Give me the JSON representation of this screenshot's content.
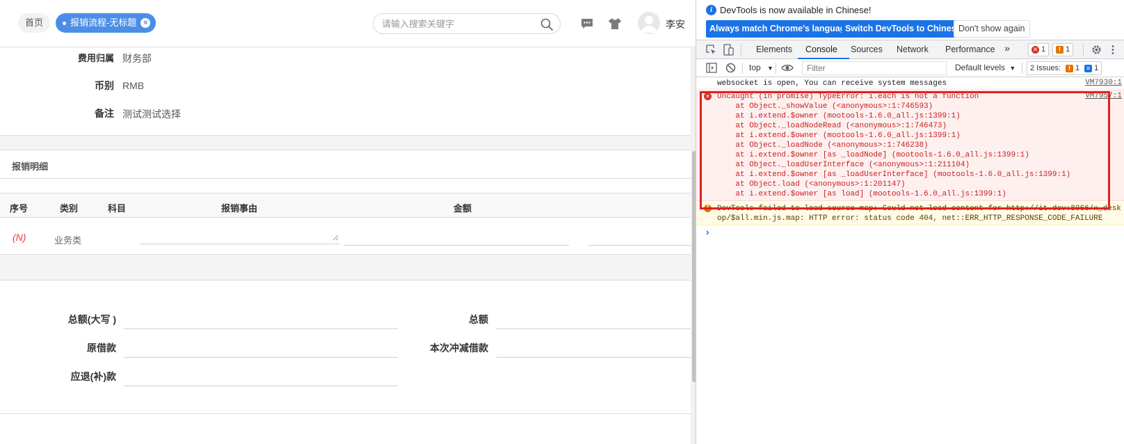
{
  "app": {
    "tabs": {
      "home": "首页",
      "active": "报销流程-无标题",
      "close": "×"
    },
    "search": {
      "placeholder": "请输入搜索关键字"
    },
    "user": {
      "name": "李安"
    },
    "info_fields": [
      {
        "label": "费用归属",
        "value": "财务部"
      },
      {
        "label": "币别",
        "value": "RMB"
      },
      {
        "label": "备注",
        "value": "测试测试选择"
      }
    ],
    "section_title": "报销明细",
    "table": {
      "headers": [
        "序号",
        "类别",
        "科目",
        "报销事由",
        "金额"
      ],
      "row": {
        "mark": "(N)",
        "category": "业务类"
      }
    },
    "summary": {
      "total_upper": "总额(大写 )",
      "total": "总额",
      "original_loan": "原借款",
      "offset_loan": "本次冲减借款",
      "refund": "应退(补)款"
    }
  },
  "devtools": {
    "info": {
      "text": "DevTools is now available in Chinese!",
      "btn_match": "Always match Chrome's language",
      "btn_switch": "Switch DevTools to Chinese",
      "btn_dismiss": "Don't show again"
    },
    "tabs": [
      "Elements",
      "Console",
      "Sources",
      "Network",
      "Performance"
    ],
    "more": "»",
    "error_count": "1",
    "warn_count": "1",
    "toolbar": {
      "context": "top",
      "filter_placeholder": "Filter",
      "levels": "Default levels",
      "issues_label": "2 Issues:",
      "issues_warn": "1",
      "issues_info": "1"
    },
    "messages": {
      "info": {
        "text": "websocket is open, You can receive system messages",
        "source": "VM7930:1"
      },
      "error": {
        "source": "VM7957:1",
        "lines": [
          "Uncaught (in promise) TypeError: i.each is not a function",
          "    at Object._showValue (<anonymous>:1:746593)",
          "    at i.extend.$owner (mootools-1.6.0_all.js:1399:1)",
          "    at Object._loadNodeRead (<anonymous>:1:746473)",
          "    at i.extend.$owner (mootools-1.6.0_all.js:1399:1)",
          "    at Object._loadNode (<anonymous>:1:746238)",
          "    at i.extend.$owner [as _loadNode] (mootools-1.6.0_all.js:1399:1)",
          "    at Object._loadUserInterface (<anonymous>:1:211104)",
          "    at i.extend.$owner [as _loadUserInterface] (mootools-1.6.0_all.js:1399:1)",
          "    at Object.load (<anonymous>:1:201147)",
          "    at i.extend.$owner [as load] (mootools-1.6.0_all.js:1399:1)"
        ]
      },
      "warn": {
        "line1": "DevTools failed to load source map: Could not load content for http://it.dev:8066/x_desk",
        "line2": "op/$all.min.js.map: HTTP error: status code 404, net::ERR_HTTP_RESPONSE_CODE_FAILURE"
      },
      "prompt": "›"
    }
  },
  "colors": {
    "accent": "#4b8ee8",
    "error": "#e0201e",
    "devtools_blue": "#1a73e8"
  }
}
